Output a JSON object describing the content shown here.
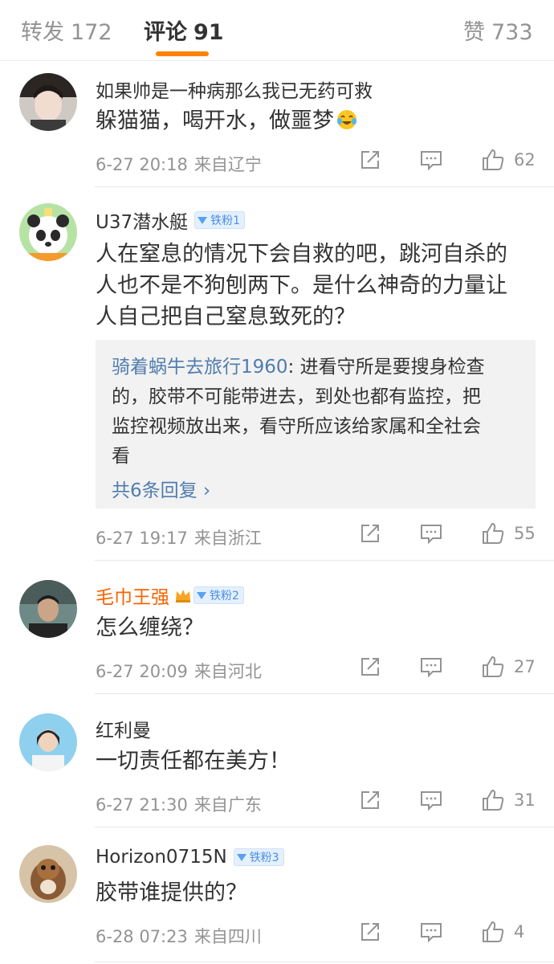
{
  "tabs": {
    "repost": {
      "label": "转发",
      "count": "172"
    },
    "comment": {
      "label": "评论",
      "count": "91"
    },
    "like": {
      "label": "赞",
      "count": "733"
    }
  },
  "comments": [
    {
      "username": "如果帅是一种病那么我已无药可救",
      "text": "躲猫猫，喝开水，做噩梦",
      "emoji": "laugh-cry-emoji",
      "time": "6-27 20:18",
      "location": "来自辽宁",
      "likes": "62"
    },
    {
      "username": "U37潜水艇",
      "badge": "铁粉1",
      "text_lines": [
        "人在窒息的情况下会自救的吧，跳河自杀的",
        "人也不是不狗刨两下。是什么神奇的力量让",
        "人自己把自己窒息致死的？"
      ],
      "reply": {
        "user": "骑着蜗牛去旅行1960",
        "sep": ":",
        "line1": " 进看守所是要搜身检查",
        "lines": [
          "的，胶带不可能带进去，到处也都有监控，把",
          "监控视频放出来，看守所应该给家属和全社会",
          "看"
        ],
        "more": "共6条回复 ›"
      },
      "time": "6-27 19:17",
      "location": "来自浙江",
      "likes": "55"
    },
    {
      "username": "毛巾王强",
      "badge": "铁粉2",
      "text": "怎么缠绕？",
      "time": "6-27 20:09",
      "location": "来自河北",
      "likes": "27"
    },
    {
      "username": "红利曼",
      "text": "一切责任都在美方！",
      "time": "6-27 21:30",
      "location": "来自广东",
      "likes": "31"
    },
    {
      "username": "Horizon0715N",
      "badge": "铁粉3",
      "text": "胶带谁提供的？",
      "time": "6-28 07:23",
      "location": "来自四川",
      "likes": "4"
    }
  ],
  "colors": {
    "accent": "#ff8200",
    "link": "#507daf",
    "vip_name": "#f86400",
    "badge_bg": "#e4f0fd",
    "badge_text": "#4a8ee6",
    "meta": "#939393"
  }
}
